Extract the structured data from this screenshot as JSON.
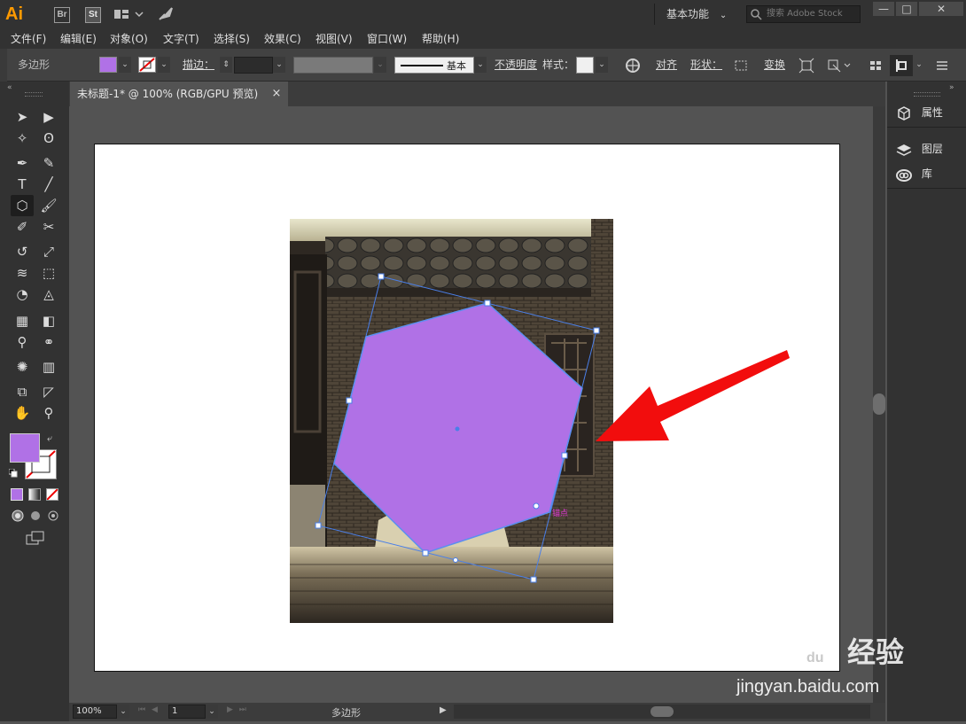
{
  "app": {
    "logo": "Ai",
    "bridge_label": "Br",
    "stock_label": "St",
    "workspace": "基本功能",
    "search_placeholder": "搜索 Adobe Stock"
  },
  "window_controls": {
    "minimize": "—",
    "maximize": "□",
    "close": "✕"
  },
  "menu": [
    "文件(F)",
    "编辑(E)",
    "对象(O)",
    "文字(T)",
    "选择(S)",
    "效果(C)",
    "视图(V)",
    "窗口(W)",
    "帮助(H)"
  ],
  "control_bar": {
    "selection_type": "多边形",
    "stroke_label": "描边：",
    "stroke_profile": "基本",
    "opacity_label": "不透明度",
    "style_label": "样式：",
    "align_label": "对齐",
    "shape_label": "形状：",
    "transform_label": "变换"
  },
  "document_tab": {
    "title": "未标题-1* @ 100% (RGB/GPU 预览)",
    "close": "×"
  },
  "right_panel": {
    "properties": "属性",
    "layers": "图层",
    "libraries": "库"
  },
  "canvas": {
    "hint_label": "锚点",
    "fill_color": "#b071e6",
    "selection_color": "#4a7fe8",
    "arrow_color": "#f20d0d"
  },
  "status_bar": {
    "zoom": "100%",
    "page": "1",
    "tool_label": "多边形"
  },
  "watermark": {
    "brand_text": "Bai",
    "brand_text2": "du",
    "product": "经验",
    "url": "jingyan.baidu.com"
  },
  "tools": [
    "selection-tool",
    "direct-selection-tool",
    "magic-wand-tool",
    "lasso-tool",
    "pen-tool",
    "curvature-tool",
    "type-tool",
    "line-tool",
    "polygon-tool",
    "paintbrush-tool",
    "shaper-tool",
    "scissors-tool",
    "rotate-tool",
    "scale-tool",
    "warp-tool",
    "free-transform-tool",
    "shape-builder-tool",
    "perspective-tool",
    "mesh-tool",
    "gradient-tool",
    "eyedropper-tool",
    "blend-tool",
    "symbol-sprayer-tool",
    "column-graph-tool",
    "artboard-tool",
    "slice-tool",
    "hand-tool",
    "zoom-tool"
  ]
}
